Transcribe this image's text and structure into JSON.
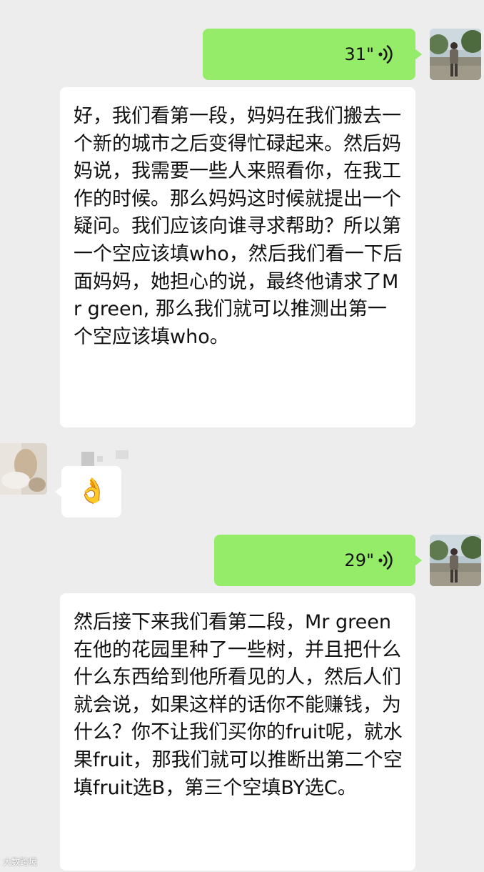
{
  "messages": [
    {
      "type": "voice",
      "side": "right",
      "duration": "31\""
    },
    {
      "type": "text",
      "side": "left",
      "text": "好，我们看第一段，妈妈在我们搬去一个新的城市之后变得忙碌起来。然后妈妈说，我需要一些人来照看你，在我工作的时候。那么妈妈这时候就提出一个疑问。我们应该向谁寻求帮助？所以第一个空应该填who，然后我们看一下后面妈妈，她担心的说，最终他请求了Mr green, 那么我们就可以推测出第一个空应该填who。"
    },
    {
      "type": "emoji",
      "side": "left",
      "emoji": "👌",
      "emoji_name": "ok-hand-icon"
    },
    {
      "type": "voice",
      "side": "right",
      "duration": "29\""
    },
    {
      "type": "text",
      "side": "left",
      "text": "然后接下来我们看第二段，Mr green在他的花园里种了一些树，并且把什么什么东西给到他所看见的人，然后人们就会说，如果这样的话你不能赚钱，为什么？你不让我们买你的fruit呢，就水果fruit，那我们就可以推断出第二个空填fruit选B，第三个空填BY选C。"
    }
  ],
  "watermark": "大数跨境",
  "colors": {
    "background": "#ededed",
    "self_bubble": "#95ec69",
    "other_bubble": "#ffffff"
  }
}
